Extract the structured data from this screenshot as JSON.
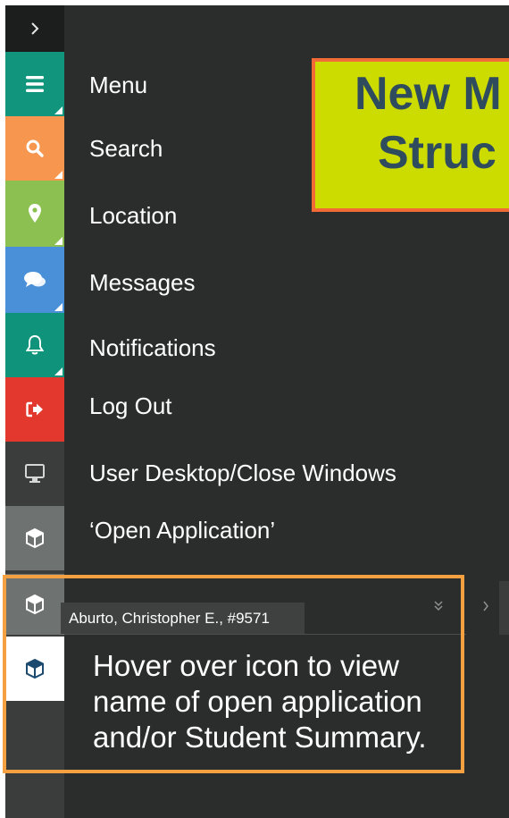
{
  "rail": {
    "expand_icon": "chevron-right-icon",
    "items": [
      {
        "label": "Menu",
        "icon": "hamburger-icon",
        "color": "#12957d"
      },
      {
        "label": "Search",
        "icon": "search-icon",
        "color": "#f7964f"
      },
      {
        "label": "Location",
        "icon": "map-pin-icon",
        "color": "#8cc152"
      },
      {
        "label": "Messages",
        "icon": "chat-bubbles-icon",
        "color": "#4a90d9"
      },
      {
        "label": "Notifications",
        "icon": "bell-icon",
        "color": "#0f937b"
      },
      {
        "label": "Log Out",
        "icon": "sign-out-icon",
        "color": "#e2382d"
      },
      {
        "label": "User Desktop/Close Windows",
        "icon": "desktop-icon",
        "color": "#3a3d3c"
      },
      {
        "label": "‘Open Application’",
        "icon": "cube-icon",
        "color": "#6e7271"
      }
    ]
  },
  "banner": {
    "line1": "New M",
    "line2": "Struc",
    "bg_color": "#cddc00",
    "border_color": "#f26a35"
  },
  "tooltip": {
    "text": "Aburto, Christopher E., #9571"
  },
  "callout": {
    "lines": [
      "Hover over icon to view",
      "name of open application",
      "and/or Student Summary."
    ],
    "border_color": "#f5a142"
  }
}
